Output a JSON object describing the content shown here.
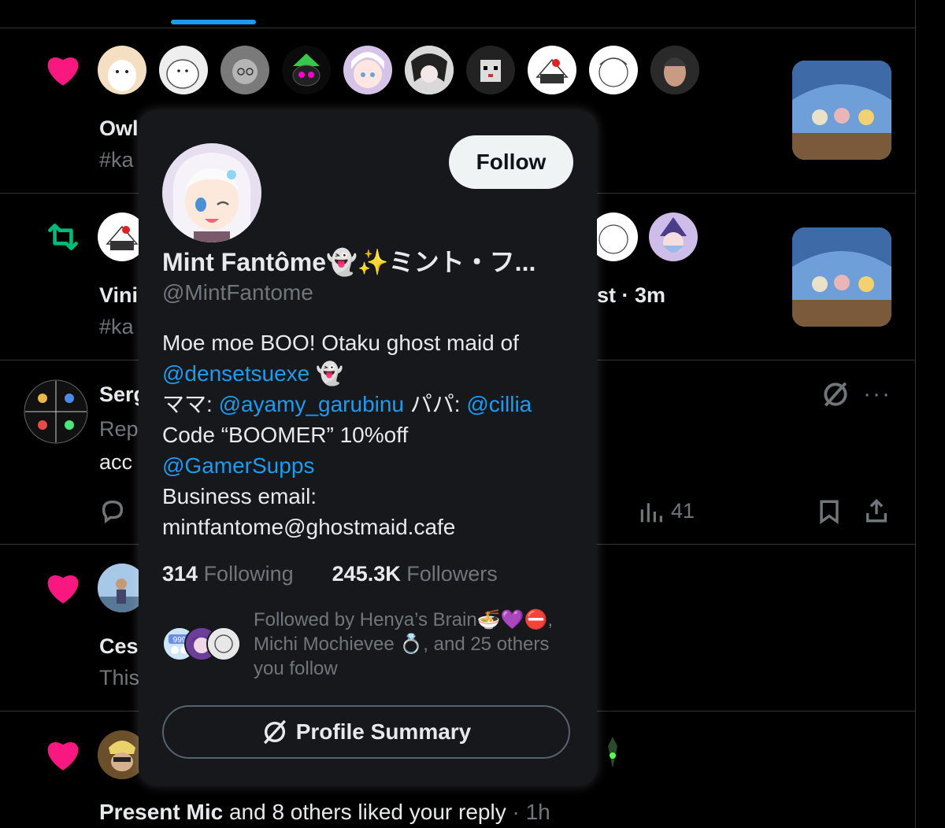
{
  "feed": {
    "row1": {
      "name_partial": "Owl",
      "tag_partial": "#ka"
    },
    "row2": {
      "name_partial": "Vini",
      "tag_partial": "#ka",
      "meta_tail": "st · 3m"
    },
    "row3": {
      "name_partial": "Serg",
      "sub_partial": "Rep",
      "text_partial": "acc",
      "views": "41"
    },
    "row4": {
      "name_partial": "Ces",
      "text_partial": "This"
    },
    "row5": {
      "name": "Present Mic",
      "text": " and 8 others liked your reply",
      "time": " · 1h"
    }
  },
  "hover_card": {
    "display_name": "Mint Fantôme👻✨ミント・フ...",
    "handle": "@MintFantome",
    "follow_label": "Follow",
    "bio": {
      "line1": "Moe moe BOO! Otaku ghost maid of",
      "mention1": "@densetsuexe",
      "ghost": " 👻",
      "mama_label": "ママ: ",
      "mention2": "@ayamy_garubinu",
      "papa_label": " パパ: ",
      "mention3": "@cillia",
      "code_line": "Code “BOOMER” 10%off",
      "mention4": "@GamerSupps",
      "business_label": "Business email:",
      "email": "mintfantome@ghostmaid.cafe"
    },
    "following_count": "314",
    "following_label": " Following",
    "followers_count": "245.3K",
    "followers_label": " Followers",
    "followed_by": "Followed by Henya’s Brain🍜💜⛔, Michi Mochievee 💍, and 25 others you follow",
    "summary_label": "Profile Summary",
    "followed_by_avatar_text": "999"
  },
  "colors": {
    "accent": "#1d9bf0",
    "like": "#f91880",
    "repost": "#00ba7c",
    "muted": "#71767b"
  }
}
